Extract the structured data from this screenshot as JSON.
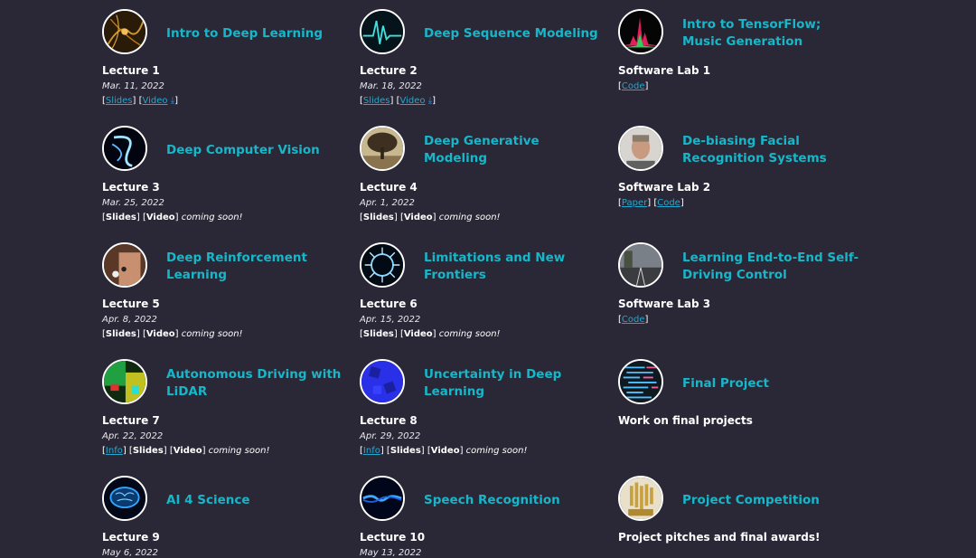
{
  "colors": {
    "background": "#2a2836",
    "accent": "#17b6c9",
    "link": "#22a8d0"
  },
  "cards": [
    {
      "id": "lec1",
      "title": "Intro to Deep Learning",
      "label": "Lecture 1",
      "date": "Mar. 11, 2022",
      "icon": "neural-filaments-icon",
      "links": {
        "a": "Slides",
        "b": "Video"
      }
    },
    {
      "id": "lec2",
      "title": "Deep Sequence Modeling",
      "label": "Lecture 2",
      "date": "Mar. 18, 2022",
      "icon": "waveform-icon",
      "links": {
        "a": "Slides",
        "b": "Video"
      }
    },
    {
      "id": "lab1",
      "title": "Intro to TensorFlow; Music Generation",
      "label": "Software Lab 1",
      "icon": "spectrum-icon",
      "links": {
        "a": "Code"
      }
    },
    {
      "id": "lec3",
      "title": "Deep Computer Vision",
      "label": "Lecture 3",
      "date": "Mar. 25, 2022",
      "icon": "light-swirl-icon",
      "links": {
        "a": "Slides",
        "b": "Video",
        "soon": "coming soon!"
      }
    },
    {
      "id": "lec4",
      "title": "Deep Generative Modeling",
      "label": "Lecture 4",
      "date": "Apr. 1, 2022",
      "icon": "tree-icon",
      "links": {
        "a": "Slides",
        "b": "Video",
        "soon": "coming soon!"
      }
    },
    {
      "id": "lab2",
      "title": "De-biasing Facial Recognition Systems",
      "label": "Software Lab 2",
      "icon": "face-icon",
      "links": {
        "a": "Paper",
        "b": "Code"
      }
    },
    {
      "id": "lec5",
      "title": "Deep Reinforcement Learning",
      "label": "Lecture 5",
      "date": "Apr. 8, 2022",
      "icon": "go-board-icon",
      "links": {
        "a": "Slides",
        "b": "Video",
        "soon": "coming soon!"
      }
    },
    {
      "id": "lec6",
      "title": "Limitations and New Frontiers",
      "label": "Lecture 6",
      "date": "Apr. 15, 2022",
      "icon": "burst-icon",
      "links": {
        "a": "Slides",
        "b": "Video",
        "soon": "coming soon!"
      }
    },
    {
      "id": "lab3",
      "title": "Learning End-to-End Self-Driving Control",
      "label": "Software Lab 3",
      "icon": "road-icon",
      "links": {
        "a": "Code"
      }
    },
    {
      "id": "lec7",
      "title": "Autonomous Driving with LiDAR",
      "label": "Lecture 7",
      "date": "Apr. 22, 2022",
      "icon": "lidar-icon",
      "links": {
        "a": "Info",
        "b": "Slides",
        "c": "Video",
        "soon": "coming soon!"
      }
    },
    {
      "id": "lec8",
      "title": "Uncertainty in Deep Learning",
      "label": "Lecture 8",
      "date": "Apr. 29, 2022",
      "icon": "dice-icon",
      "links": {
        "a": "Info",
        "b": "Slides",
        "c": "Video",
        "soon": "coming soon!"
      }
    },
    {
      "id": "final",
      "title": "Final Project",
      "label": "Work on final projects",
      "icon": "code-screen-icon"
    },
    {
      "id": "lec9",
      "title": "AI 4 Science",
      "label": "Lecture 9",
      "date": "May 6, 2022",
      "icon": "brain-icon"
    },
    {
      "id": "lec10",
      "title": "Speech Recognition",
      "label": "Lecture 10",
      "date": "May 13, 2022",
      "icon": "sound-wave-icon"
    },
    {
      "id": "comp",
      "title": "Project Competition",
      "label": "Project pitches and final awards!",
      "icon": "trophy-icon"
    }
  ]
}
